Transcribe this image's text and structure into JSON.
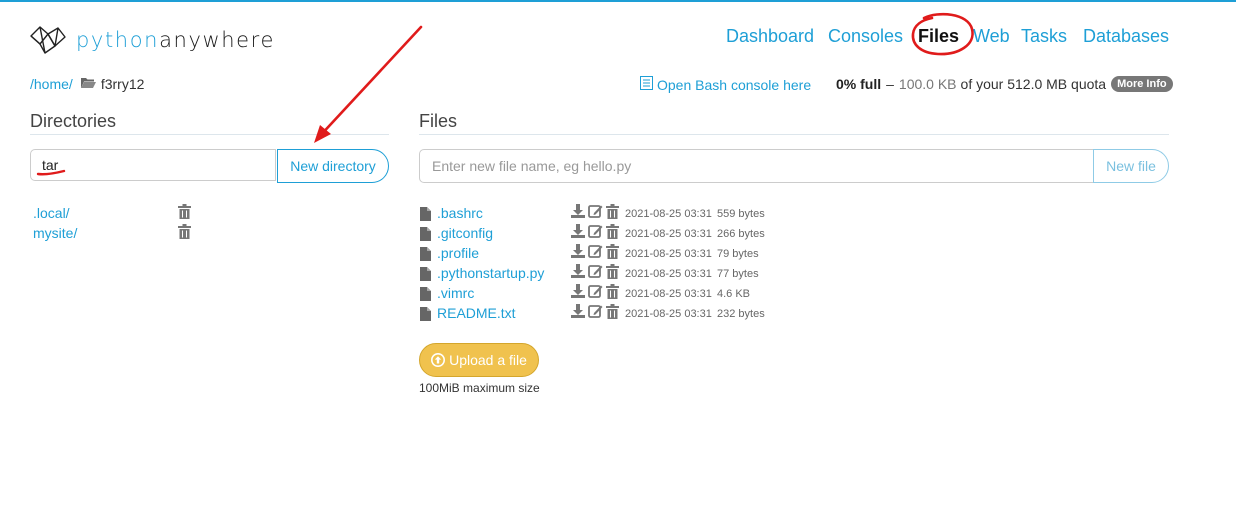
{
  "brand": {
    "part1": "python",
    "part2": "anywhere"
  },
  "nav": [
    {
      "label": "Dashboard",
      "active": false
    },
    {
      "label": "Consoles",
      "active": false
    },
    {
      "label": "Files",
      "active": true
    },
    {
      "label": "Web",
      "active": false
    },
    {
      "label": "Tasks",
      "active": false
    },
    {
      "label": "Databases",
      "active": false
    }
  ],
  "breadcrumb": {
    "home": "/home/",
    "user": "f3rry12"
  },
  "bash_link": "Open Bash console here",
  "quota": {
    "percent": "0% full",
    "dash": "–",
    "used": "100.0 KB",
    "rest": "of your 512.0 MB quota",
    "more_info": "More Info"
  },
  "directories": {
    "heading": "Directories",
    "input_value": "tar",
    "button": "New directory",
    "items": [
      {
        "name": ".local/"
      },
      {
        "name": "mysite/"
      }
    ]
  },
  "files": {
    "heading": "Files",
    "placeholder": "Enter new file name, eg hello.py",
    "button": "New file",
    "items": [
      {
        "name": ".bashrc",
        "date": "2021-08-25 03:31",
        "size": "559 bytes"
      },
      {
        "name": ".gitconfig",
        "date": "2021-08-25 03:31",
        "size": "266 bytes"
      },
      {
        "name": ".profile",
        "date": "2021-08-25 03:31",
        "size": "79 bytes"
      },
      {
        "name": ".pythonstartup.py",
        "date": "2021-08-25 03:31",
        "size": "77 bytes"
      },
      {
        "name": ".vimrc",
        "date": "2021-08-25 03:31",
        "size": "4.6 KB"
      },
      {
        "name": "README.txt",
        "date": "2021-08-25 03:31",
        "size": "232 bytes"
      }
    ]
  },
  "upload": {
    "button": "Upload a file",
    "note": "100MiB maximum size"
  },
  "colors": {
    "accent": "#1e9fd6",
    "upload": "#f0c24e",
    "annotation": "#e01b1b"
  },
  "icons": [
    "logo-icon",
    "folder-icon",
    "console-icon",
    "trash-icon",
    "file-icon",
    "download-icon",
    "edit-icon",
    "upload-icon"
  ]
}
